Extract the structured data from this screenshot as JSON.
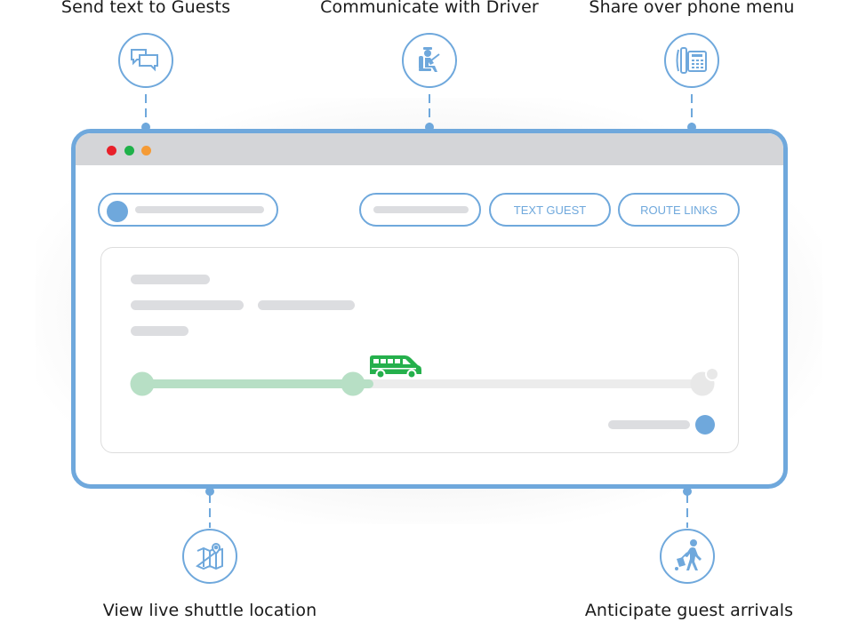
{
  "features_top": [
    {
      "label": "Send text to Guests",
      "icon": "chat-bubbles-icon"
    },
    {
      "label": "Communicate with Driver",
      "icon": "driver-seat-icon"
    },
    {
      "label": "Share over phone menu",
      "icon": "desk-phone-icon"
    }
  ],
  "features_bottom": [
    {
      "label": "View live shuttle location",
      "icon": "map-pin-icon"
    },
    {
      "label": "Anticipate guest arrivals",
      "icon": "traveler-luggage-icon"
    }
  ],
  "window": {
    "traffic_lights": {
      "close": "#e8202a",
      "minimize": "#1fb14a",
      "zoom": "#f59b36"
    },
    "buttons": {
      "text_guest": "TEXT GUEST",
      "route_links": "ROUTE LINKS"
    },
    "trip_progress": {
      "progress_fraction": 0.42,
      "vehicle_icon": "shuttle-van-icon",
      "stops": 3
    }
  },
  "colors": {
    "accent": "#6fa8dc",
    "progress_green": "#b7dfc5",
    "vehicle_green": "#25b04c",
    "skeleton": "#dcdde0",
    "track": "#ececec"
  }
}
